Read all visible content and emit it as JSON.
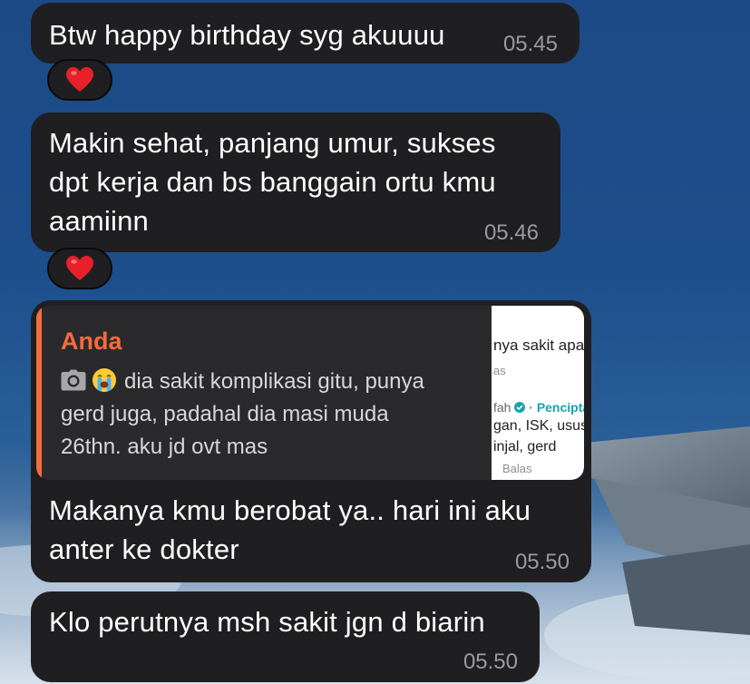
{
  "messages": [
    {
      "text": "Btw happy birthday syg akuuuu",
      "time": "05.45",
      "reaction": "heart"
    },
    {
      "text": "Makin sehat, panjang umur, sukses\ndpt kerja dan bs banggain ortu kmu\naamiinn",
      "time": "05.46",
      "reaction": "heart"
    },
    {
      "reply": {
        "author": "Anda",
        "camera_icon": "camera-icon",
        "emoji_icon": "crying-face-emoji",
        "text": "dia sakit komplikasi gitu, punya\ngerd juga, padahal dia masi muda\n26thn. aku jd ovt mas",
        "thumbnail": {
          "line1": "nya sakit apa?",
          "line2": "as",
          "author": "fah",
          "tag": "Pencipta",
          "line3": "gan, ISK, usus",
          "line4": "injal, gerd",
          "reply_label": "Balas"
        }
      },
      "text": "Makanya kmu berobat ya.. hari ini aku\nanter ke dokter",
      "time": "05.50"
    },
    {
      "text": "Klo perutnya msh sakit jgn d biarin",
      "time": "05.50"
    }
  ],
  "icons": {
    "reaction": "heart-icon",
    "verified": "verified-icon"
  },
  "colors": {
    "bubble": "#1f1f21",
    "reply_accent": "#f46c3c",
    "timestamp": "#9b9b9e",
    "heart": "#e8202a"
  }
}
